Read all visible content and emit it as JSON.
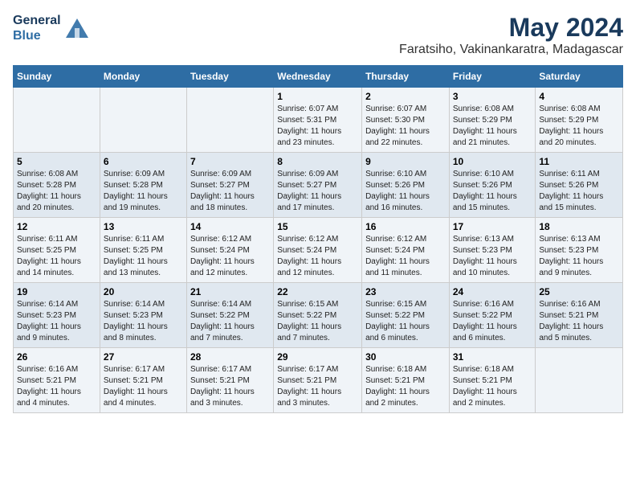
{
  "header": {
    "logo_line1": "General",
    "logo_line2": "Blue",
    "month_year": "May 2024",
    "location": "Faratsiho, Vakinankaratra, Madagascar"
  },
  "days_of_week": [
    "Sunday",
    "Monday",
    "Tuesday",
    "Wednesday",
    "Thursday",
    "Friday",
    "Saturday"
  ],
  "weeks": [
    [
      {
        "day": "",
        "info": ""
      },
      {
        "day": "",
        "info": ""
      },
      {
        "day": "",
        "info": ""
      },
      {
        "day": "1",
        "info": "Sunrise: 6:07 AM\nSunset: 5:31 PM\nDaylight: 11 hours\nand 23 minutes."
      },
      {
        "day": "2",
        "info": "Sunrise: 6:07 AM\nSunset: 5:30 PM\nDaylight: 11 hours\nand 22 minutes."
      },
      {
        "day": "3",
        "info": "Sunrise: 6:08 AM\nSunset: 5:29 PM\nDaylight: 11 hours\nand 21 minutes."
      },
      {
        "day": "4",
        "info": "Sunrise: 6:08 AM\nSunset: 5:29 PM\nDaylight: 11 hours\nand 20 minutes."
      }
    ],
    [
      {
        "day": "5",
        "info": "Sunrise: 6:08 AM\nSunset: 5:28 PM\nDaylight: 11 hours\nand 20 minutes."
      },
      {
        "day": "6",
        "info": "Sunrise: 6:09 AM\nSunset: 5:28 PM\nDaylight: 11 hours\nand 19 minutes."
      },
      {
        "day": "7",
        "info": "Sunrise: 6:09 AM\nSunset: 5:27 PM\nDaylight: 11 hours\nand 18 minutes."
      },
      {
        "day": "8",
        "info": "Sunrise: 6:09 AM\nSunset: 5:27 PM\nDaylight: 11 hours\nand 17 minutes."
      },
      {
        "day": "9",
        "info": "Sunrise: 6:10 AM\nSunset: 5:26 PM\nDaylight: 11 hours\nand 16 minutes."
      },
      {
        "day": "10",
        "info": "Sunrise: 6:10 AM\nSunset: 5:26 PM\nDaylight: 11 hours\nand 15 minutes."
      },
      {
        "day": "11",
        "info": "Sunrise: 6:11 AM\nSunset: 5:26 PM\nDaylight: 11 hours\nand 15 minutes."
      }
    ],
    [
      {
        "day": "12",
        "info": "Sunrise: 6:11 AM\nSunset: 5:25 PM\nDaylight: 11 hours\nand 14 minutes."
      },
      {
        "day": "13",
        "info": "Sunrise: 6:11 AM\nSunset: 5:25 PM\nDaylight: 11 hours\nand 13 minutes."
      },
      {
        "day": "14",
        "info": "Sunrise: 6:12 AM\nSunset: 5:24 PM\nDaylight: 11 hours\nand 12 minutes."
      },
      {
        "day": "15",
        "info": "Sunrise: 6:12 AM\nSunset: 5:24 PM\nDaylight: 11 hours\nand 12 minutes."
      },
      {
        "day": "16",
        "info": "Sunrise: 6:12 AM\nSunset: 5:24 PM\nDaylight: 11 hours\nand 11 minutes."
      },
      {
        "day": "17",
        "info": "Sunrise: 6:13 AM\nSunset: 5:23 PM\nDaylight: 11 hours\nand 10 minutes."
      },
      {
        "day": "18",
        "info": "Sunrise: 6:13 AM\nSunset: 5:23 PM\nDaylight: 11 hours\nand 9 minutes."
      }
    ],
    [
      {
        "day": "19",
        "info": "Sunrise: 6:14 AM\nSunset: 5:23 PM\nDaylight: 11 hours\nand 9 minutes."
      },
      {
        "day": "20",
        "info": "Sunrise: 6:14 AM\nSunset: 5:23 PM\nDaylight: 11 hours\nand 8 minutes."
      },
      {
        "day": "21",
        "info": "Sunrise: 6:14 AM\nSunset: 5:22 PM\nDaylight: 11 hours\nand 7 minutes."
      },
      {
        "day": "22",
        "info": "Sunrise: 6:15 AM\nSunset: 5:22 PM\nDaylight: 11 hours\nand 7 minutes."
      },
      {
        "day": "23",
        "info": "Sunrise: 6:15 AM\nSunset: 5:22 PM\nDaylight: 11 hours\nand 6 minutes."
      },
      {
        "day": "24",
        "info": "Sunrise: 6:16 AM\nSunset: 5:22 PM\nDaylight: 11 hours\nand 6 minutes."
      },
      {
        "day": "25",
        "info": "Sunrise: 6:16 AM\nSunset: 5:21 PM\nDaylight: 11 hours\nand 5 minutes."
      }
    ],
    [
      {
        "day": "26",
        "info": "Sunrise: 6:16 AM\nSunset: 5:21 PM\nDaylight: 11 hours\nand 4 minutes."
      },
      {
        "day": "27",
        "info": "Sunrise: 6:17 AM\nSunset: 5:21 PM\nDaylight: 11 hours\nand 4 minutes."
      },
      {
        "day": "28",
        "info": "Sunrise: 6:17 AM\nSunset: 5:21 PM\nDaylight: 11 hours\nand 3 minutes."
      },
      {
        "day": "29",
        "info": "Sunrise: 6:17 AM\nSunset: 5:21 PM\nDaylight: 11 hours\nand 3 minutes."
      },
      {
        "day": "30",
        "info": "Sunrise: 6:18 AM\nSunset: 5:21 PM\nDaylight: 11 hours\nand 2 minutes."
      },
      {
        "day": "31",
        "info": "Sunrise: 6:18 AM\nSunset: 5:21 PM\nDaylight: 11 hours\nand 2 minutes."
      },
      {
        "day": "",
        "info": ""
      }
    ]
  ]
}
